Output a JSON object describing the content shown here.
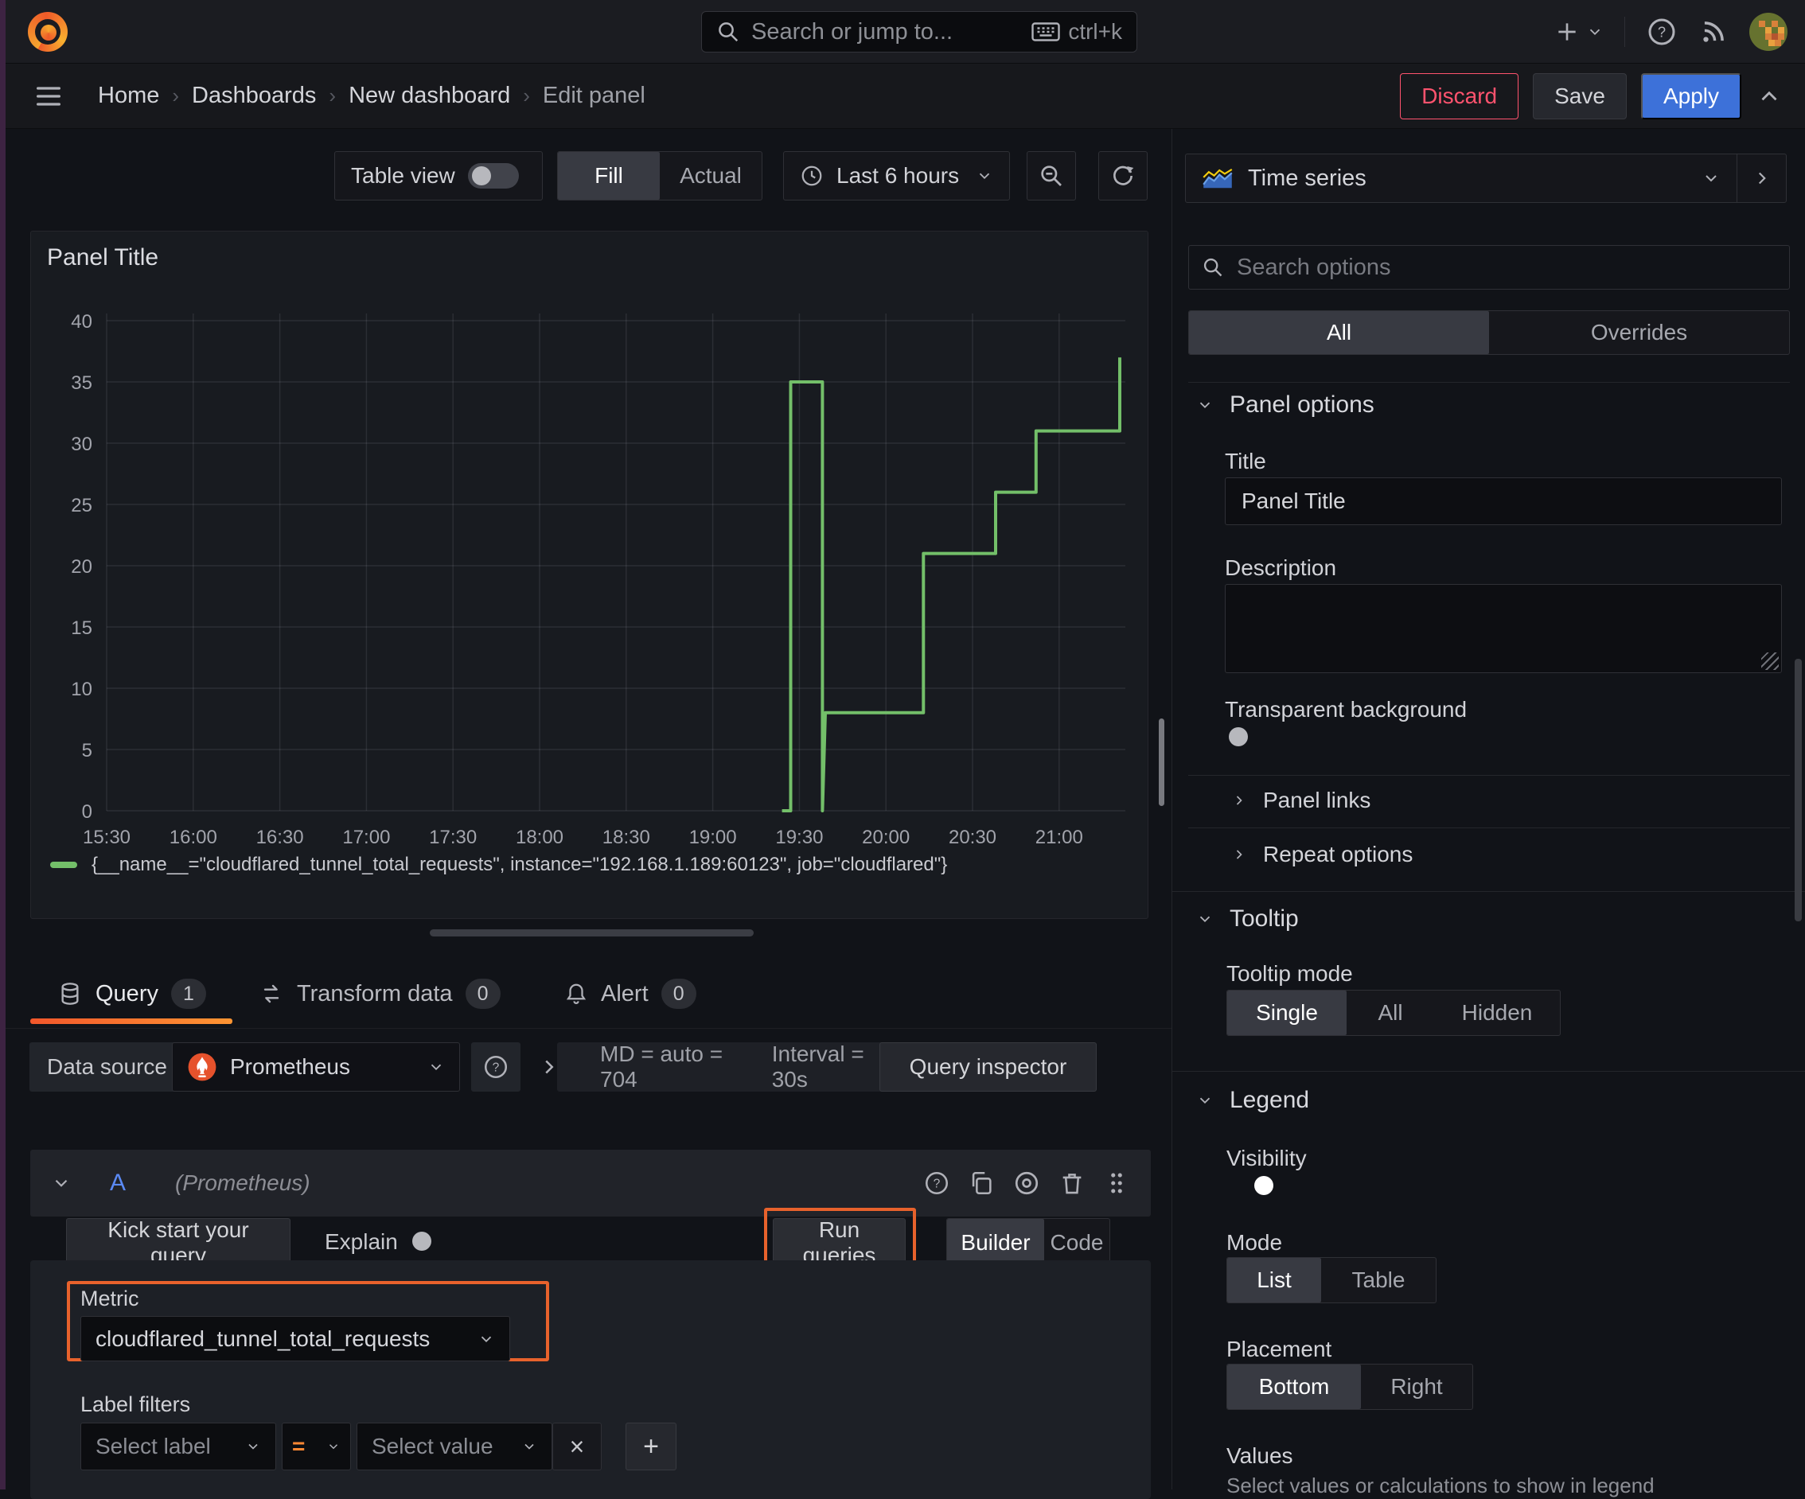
{
  "topbar": {
    "search_placeholder": "Search or jump to...",
    "shortcut": "ctrl+k"
  },
  "breadcrumb": {
    "items": [
      "Home",
      "Dashboards",
      "New dashboard",
      "Edit panel"
    ],
    "discard": "Discard",
    "save": "Save",
    "apply": "Apply"
  },
  "preview_toolbar": {
    "table_view": "Table view",
    "fill": "Fill",
    "actual": "Actual",
    "time_range": "Last 6 hours"
  },
  "panel": {
    "title": "Panel Title"
  },
  "chart_data": {
    "type": "line",
    "title": "Panel Title",
    "x_ticks": [
      "15:30",
      "16:00",
      "16:30",
      "17:00",
      "17:30",
      "18:00",
      "18:30",
      "19:00",
      "19:30",
      "20:00",
      "20:30",
      "21:00"
    ],
    "y_ticks": [
      0,
      5,
      10,
      15,
      20,
      25,
      30,
      35,
      40
    ],
    "ylim": [
      0,
      40
    ],
    "grid": true,
    "legend_position": "bottom",
    "series": [
      {
        "name": "{__name__=\"cloudflared_tunnel_total_requests\", instance=\"192.168.1.189:60123\", job=\"cloudflared\"}",
        "color": "#73bf69",
        "points": [
          [
            "19:24",
            0
          ],
          [
            "19:27",
            0
          ],
          [
            "19:27",
            35
          ],
          [
            "19:38",
            35
          ],
          [
            "19:38",
            0
          ],
          [
            "19:39",
            8
          ],
          [
            "20:13",
            8
          ],
          [
            "20:13",
            21
          ],
          [
            "20:38",
            21
          ],
          [
            "20:38",
            26
          ],
          [
            "20:52",
            26
          ],
          [
            "20:52",
            31
          ],
          [
            "21:21",
            31
          ],
          [
            "21:21",
            37
          ]
        ]
      }
    ]
  },
  "tabs": {
    "query": "Query",
    "query_count": "1",
    "transform": "Transform data",
    "transform_count": "0",
    "alert": "Alert",
    "alert_count": "0"
  },
  "query": {
    "datasource_label": "Data source",
    "datasource_name": "Prometheus",
    "stats_md": "MD = auto = 704",
    "stats_interval": "Interval = 30s",
    "inspector": "Query inspector",
    "row_ref": "A",
    "row_ds": "(Prometheus)",
    "kickstart": "Kick start your query",
    "explain": "Explain",
    "run": "Run queries",
    "builder": "Builder",
    "code": "Code",
    "metric_label": "Metric",
    "metric_value": "cloudflared_tunnel_total_requests",
    "label_filters_label": "Label filters",
    "select_label_placeholder": "Select label",
    "operator": "=",
    "select_value_placeholder": "Select value"
  },
  "options": {
    "viz_type": "Time series",
    "search_placeholder": "Search options",
    "tab_all": "All",
    "tab_overrides": "Overrides",
    "panel_options": {
      "heading": "Panel options",
      "title_label": "Title",
      "title_value": "Panel Title",
      "description_label": "Description",
      "transparent_label": "Transparent background"
    },
    "links": "Panel links",
    "repeat": "Repeat options",
    "tooltip": {
      "heading": "Tooltip",
      "mode_label": "Tooltip mode",
      "single": "Single",
      "all": "All",
      "hidden": "Hidden"
    },
    "legend": {
      "heading": "Legend",
      "visibility_label": "Visibility",
      "mode_label": "Mode",
      "list": "List",
      "table": "Table",
      "placement_label": "Placement",
      "bottom": "Bottom",
      "right": "Right",
      "values_label": "Values",
      "values_help": "Select values or calculations to show in legend"
    }
  },
  "colors": {
    "accent_orange": "#ff8833",
    "highlight": "#e8622c",
    "apply_blue": "#3d71d9",
    "danger": "#ff536e",
    "series_green": "#73bf69",
    "toggle_on": "#3d71d9"
  }
}
